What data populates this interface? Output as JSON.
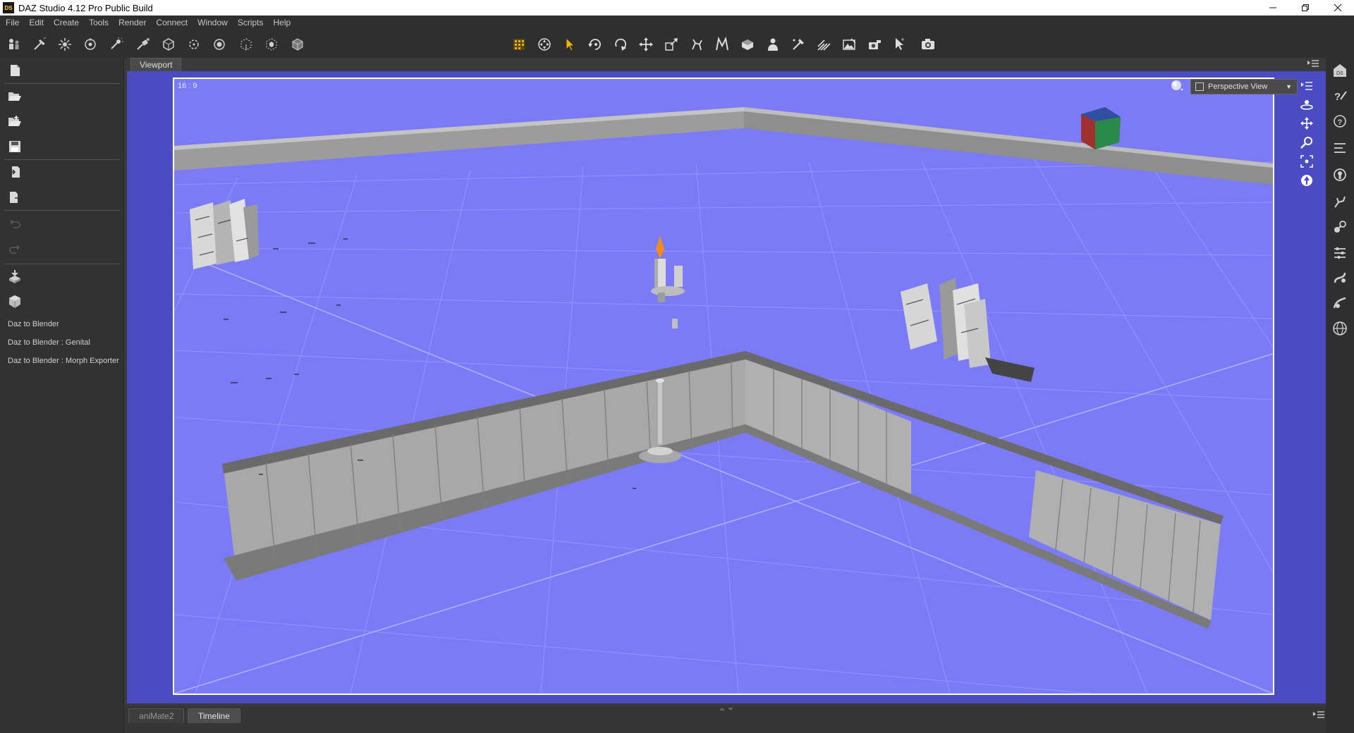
{
  "window": {
    "title": "DAZ Studio 4.12 Pro Public Build",
    "app_icon": "DS",
    "controls": [
      "minimize",
      "restore",
      "close"
    ]
  },
  "menu": [
    "File",
    "Edit",
    "Create",
    "Tools",
    "Render",
    "Connect",
    "Window",
    "Scripts",
    "Help"
  ],
  "toolbar": {
    "left_tools": [
      "create-figure-icon",
      "spot-light-icon",
      "point-light-icon",
      "distant-light-icon",
      "ambient-light-icon",
      "linear-point-light-icon",
      "create-camera-icon",
      "create-node-icon",
      "create-null-icon",
      "create-primitive-icon",
      "group-node-icon",
      "instance-icon",
      "proxy-icon"
    ],
    "center_tools": [
      "render-settings-icon",
      "universal-tool-icon",
      "node-selection-icon",
      "rotate-icon",
      "scale-icon",
      "translate-icon",
      "transform-icon",
      "joint-editor-icon",
      "power-pose-icon",
      "active-pose-icon",
      "surface-selection-icon",
      "geometry-editor-icon",
      "region-navigator-icon",
      "spot-render-icon",
      "render-icon",
      "camera-icon"
    ]
  },
  "left_panel": {
    "actions": [
      "new-scene-icon",
      "open-icon",
      "merge-icon",
      "save-icon",
      "import-icon",
      "export-icon",
      "undo-icon",
      "redo-icon",
      "daz-to-blender-icon",
      "morph-export-icon"
    ],
    "scripts": [
      "Daz to Blender",
      "Daz to Blender : Genital",
      "Daz to Blender : Morph Exporter"
    ]
  },
  "viewport": {
    "tab": "Viewport",
    "aspect": "16 : 9",
    "view": "Perspective View",
    "colors": {
      "frame": "#4b4bc2",
      "background": "#7b7bf8",
      "grid": "#9a9aff"
    }
  },
  "bottom_tabs": [
    "aniMate2",
    "Timeline"
  ],
  "active_bottom_tab": "Timeline"
}
